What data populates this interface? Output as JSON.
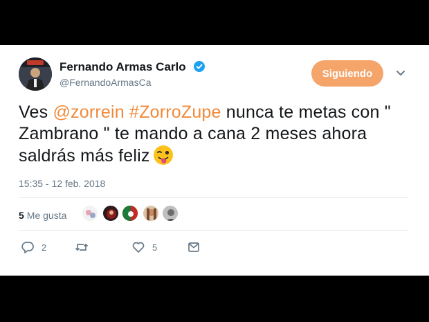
{
  "author": {
    "display_name": "Fernando Armas Carlo",
    "handle": "@FernandoArmasCa",
    "verified": true
  },
  "follow_button": {
    "label": "Siguiendo",
    "color": "#f5a46a"
  },
  "tweet": {
    "prefix": "Ves ",
    "mention": "@zorrein",
    "space1": " ",
    "hashtag": "#ZorroZupe",
    "body": " nunca te metas con \" Zambrano \" te mando a cana 2 meses ahora saldrás más feliz",
    "emoji": "winking-face-with-tongue",
    "link_color": "#f08a3a"
  },
  "timestamp": "15:35 - 12 feb. 2018",
  "stats": {
    "likes_count": "5",
    "likes_label": "Me gusta"
  },
  "actions": {
    "reply_count": "2",
    "retweet_count": "",
    "like_count": "5"
  }
}
